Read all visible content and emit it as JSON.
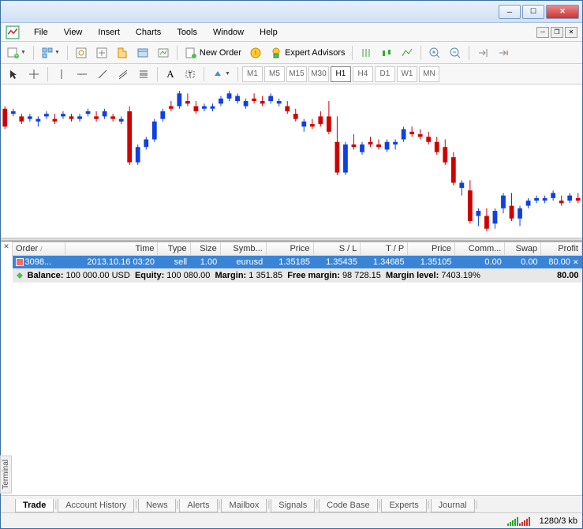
{
  "menu": {
    "file": "File",
    "view": "View",
    "insert": "Insert",
    "charts": "Charts",
    "tools": "Tools",
    "window": "Window",
    "help": "Help"
  },
  "toolbar": {
    "new_order": "New Order",
    "expert_advisors": "Expert Advisors"
  },
  "timeframes": {
    "m1": "M1",
    "m5": "M5",
    "m15": "M15",
    "m30": "M30",
    "h1": "H1",
    "h4": "H4",
    "d1": "D1",
    "w1": "W1",
    "mn": "MN"
  },
  "terminal": {
    "label": "Terminal",
    "columns": {
      "order": "Order",
      "time": "Time",
      "type": "Type",
      "size": "Size",
      "symbol": "Symb...",
      "price": "Price",
      "sl": "S / L",
      "tp": "T / P",
      "price2": "Price",
      "comm": "Comm...",
      "swap": "Swap",
      "profit": "Profit"
    },
    "rows": [
      {
        "order": "3098...",
        "time": "2013.10.16 03:20",
        "type": "sell",
        "size": "1.00",
        "symbol": "eurusd",
        "price": "1.35185",
        "sl": "1.35435",
        "tp": "1.34685",
        "price2": "1.35105",
        "comm": "0.00",
        "swap": "0.00",
        "profit": "80.00"
      }
    ],
    "summary": {
      "balance_label": "Balance:",
      "balance": "100 000.00 USD",
      "equity_label": "Equity:",
      "equity": "100 080.00",
      "margin_label": "Margin:",
      "margin": "1 351.85",
      "free_margin_label": "Free margin:",
      "free_margin": "98 728.15",
      "margin_level_label": "Margin level:",
      "margin_level": "7403.19%",
      "profit": "80.00"
    },
    "tabs": {
      "trade": "Trade",
      "account_history": "Account History",
      "news": "News",
      "alerts": "Alerts",
      "mailbox": "Mailbox",
      "signals": "Signals",
      "code_base": "Code Base",
      "experts": "Experts",
      "journal": "Journal"
    }
  },
  "status": {
    "traffic": "1280/3 kb"
  },
  "chart_data": {
    "type": "candlestick",
    "title": "",
    "timeframe": "H1",
    "candles": [
      {
        "o": 106,
        "h": 108,
        "l": 90,
        "c": 92
      },
      {
        "o": 102,
        "h": 106,
        "l": 100,
        "c": 104
      },
      {
        "o": 100,
        "h": 102,
        "l": 94,
        "c": 96
      },
      {
        "o": 98,
        "h": 102,
        "l": 96,
        "c": 100
      },
      {
        "o": 96,
        "h": 100,
        "l": 92,
        "c": 98
      },
      {
        "o": 100,
        "h": 104,
        "l": 98,
        "c": 102
      },
      {
        "o": 98,
        "h": 102,
        "l": 94,
        "c": 96
      },
      {
        "o": 100,
        "h": 104,
        "l": 98,
        "c": 102
      },
      {
        "o": 100,
        "h": 102,
        "l": 96,
        "c": 98
      },
      {
        "o": 98,
        "h": 102,
        "l": 96,
        "c": 100
      },
      {
        "o": 102,
        "h": 106,
        "l": 100,
        "c": 104
      },
      {
        "o": 100,
        "h": 104,
        "l": 96,
        "c": 98
      },
      {
        "o": 100,
        "h": 106,
        "l": 98,
        "c": 104
      },
      {
        "o": 100,
        "h": 102,
        "l": 96,
        "c": 98
      },
      {
        "o": 96,
        "h": 100,
        "l": 94,
        "c": 98
      },
      {
        "o": 104,
        "h": 108,
        "l": 62,
        "c": 64
      },
      {
        "o": 64,
        "h": 78,
        "l": 62,
        "c": 76
      },
      {
        "o": 76,
        "h": 84,
        "l": 74,
        "c": 82
      },
      {
        "o": 82,
        "h": 98,
        "l": 80,
        "c": 96
      },
      {
        "o": 98,
        "h": 106,
        "l": 96,
        "c": 104
      },
      {
        "o": 108,
        "h": 112,
        "l": 104,
        "c": 106
      },
      {
        "o": 108,
        "h": 120,
        "l": 106,
        "c": 118
      },
      {
        "o": 112,
        "h": 118,
        "l": 108,
        "c": 110
      },
      {
        "o": 108,
        "h": 112,
        "l": 102,
        "c": 104
      },
      {
        "o": 106,
        "h": 110,
        "l": 104,
        "c": 108
      },
      {
        "o": 106,
        "h": 110,
        "l": 104,
        "c": 108
      },
      {
        "o": 110,
        "h": 116,
        "l": 108,
        "c": 114
      },
      {
        "o": 114,
        "h": 120,
        "l": 112,
        "c": 118
      },
      {
        "o": 112,
        "h": 118,
        "l": 110,
        "c": 116
      },
      {
        "o": 108,
        "h": 114,
        "l": 106,
        "c": 112
      },
      {
        "o": 114,
        "h": 118,
        "l": 110,
        "c": 112
      },
      {
        "o": 112,
        "h": 116,
        "l": 108,
        "c": 110
      },
      {
        "o": 112,
        "h": 118,
        "l": 110,
        "c": 116
      },
      {
        "o": 110,
        "h": 114,
        "l": 108,
        "c": 112
      },
      {
        "o": 108,
        "h": 112,
        "l": 102,
        "c": 104
      },
      {
        "o": 102,
        "h": 106,
        "l": 96,
        "c": 98
      },
      {
        "o": 92,
        "h": 98,
        "l": 88,
        "c": 96
      },
      {
        "o": 94,
        "h": 98,
        "l": 90,
        "c": 92
      },
      {
        "o": 100,
        "h": 104,
        "l": 92,
        "c": 94
      },
      {
        "o": 100,
        "h": 112,
        "l": 86,
        "c": 88
      },
      {
        "o": 80,
        "h": 100,
        "l": 54,
        "c": 56
      },
      {
        "o": 56,
        "h": 80,
        "l": 54,
        "c": 78
      },
      {
        "o": 78,
        "h": 86,
        "l": 74,
        "c": 76
      },
      {
        "o": 72,
        "h": 80,
        "l": 70,
        "c": 78
      },
      {
        "o": 80,
        "h": 84,
        "l": 76,
        "c": 78
      },
      {
        "o": 78,
        "h": 82,
        "l": 74,
        "c": 76
      },
      {
        "o": 74,
        "h": 82,
        "l": 72,
        "c": 80
      },
      {
        "o": 78,
        "h": 82,
        "l": 74,
        "c": 80
      },
      {
        "o": 82,
        "h": 92,
        "l": 80,
        "c": 90
      },
      {
        "o": 88,
        "h": 92,
        "l": 84,
        "c": 86
      },
      {
        "o": 86,
        "h": 90,
        "l": 82,
        "c": 84
      },
      {
        "o": 84,
        "h": 88,
        "l": 78,
        "c": 80
      },
      {
        "o": 80,
        "h": 84,
        "l": 70,
        "c": 72
      },
      {
        "o": 76,
        "h": 82,
        "l": 62,
        "c": 64
      },
      {
        "o": 68,
        "h": 72,
        "l": 46,
        "c": 48
      },
      {
        "o": 44,
        "h": 50,
        "l": 38,
        "c": 48
      },
      {
        "o": 42,
        "h": 50,
        "l": 16,
        "c": 18
      },
      {
        "o": 22,
        "h": 28,
        "l": 14,
        "c": 26
      },
      {
        "o": 22,
        "h": 28,
        "l": 10,
        "c": 12
      },
      {
        "o": 16,
        "h": 28,
        "l": 12,
        "c": 26
      },
      {
        "o": 28,
        "h": 40,
        "l": 24,
        "c": 38
      },
      {
        "o": 30,
        "h": 40,
        "l": 18,
        "c": 20
      },
      {
        "o": 20,
        "h": 30,
        "l": 14,
        "c": 28
      },
      {
        "o": 30,
        "h": 36,
        "l": 28,
        "c": 34
      },
      {
        "o": 34,
        "h": 38,
        "l": 32,
        "c": 36
      },
      {
        "o": 34,
        "h": 38,
        "l": 32,
        "c": 36
      },
      {
        "o": 36,
        "h": 42,
        "l": 34,
        "c": 40
      },
      {
        "o": 34,
        "h": 38,
        "l": 30,
        "c": 32
      },
      {
        "o": 34,
        "h": 40,
        "l": 32,
        "c": 38
      },
      {
        "o": 36,
        "h": 40,
        "l": 32,
        "c": 34
      }
    ]
  }
}
